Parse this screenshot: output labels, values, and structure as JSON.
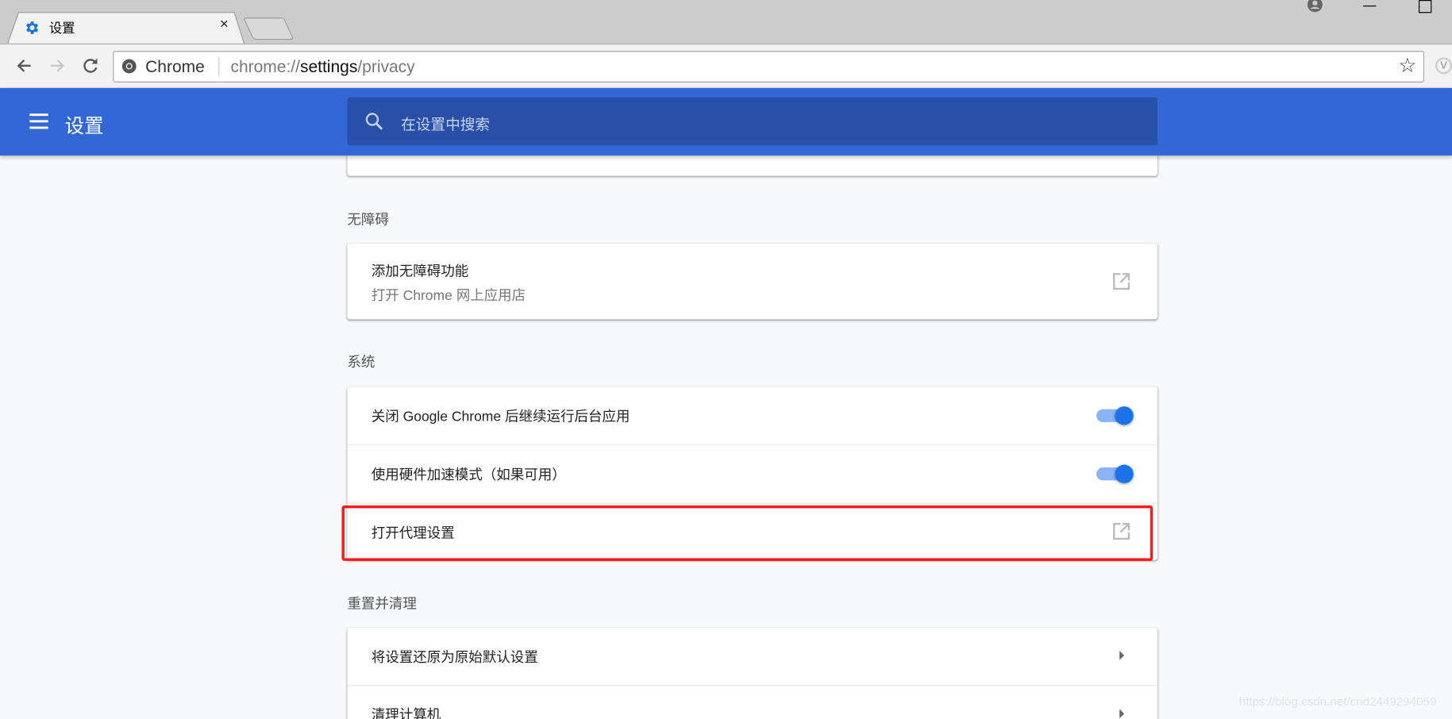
{
  "browser": {
    "tab": {
      "title": "设置",
      "icon": "gear-icon",
      "close": "×"
    },
    "omnibox": {
      "site_label": "Chrome",
      "url_prefix": "chrome://",
      "url_host": "settings",
      "url_path": "/privacy"
    }
  },
  "header": {
    "title": "设置",
    "search_placeholder": "在设置中搜索"
  },
  "sections": {
    "accessibility": {
      "title": "无障碍",
      "item_title": "添加无障碍功能",
      "item_subtitle": "打开 Chrome 网上应用店"
    },
    "system": {
      "title": "系统",
      "items": [
        {
          "label": "关闭 Google Chrome 后继续运行后台应用",
          "toggle": true
        },
        {
          "label": "使用硬件加速模式（如果可用）",
          "toggle": true
        },
        {
          "label": "打开代理设置",
          "highlighted": true
        }
      ]
    },
    "reset": {
      "title": "重置并清理",
      "items": [
        {
          "label": "将设置还原为原始默认设置"
        },
        {
          "label": "清理计算机"
        }
      ]
    }
  },
  "watermark": "https://blog.csdn.net/cnd2449294059",
  "colors": {
    "header": "#3367d6",
    "search": "#2850a8",
    "toggle_on": "#1a73e8",
    "highlight": "#ff1a1a"
  }
}
